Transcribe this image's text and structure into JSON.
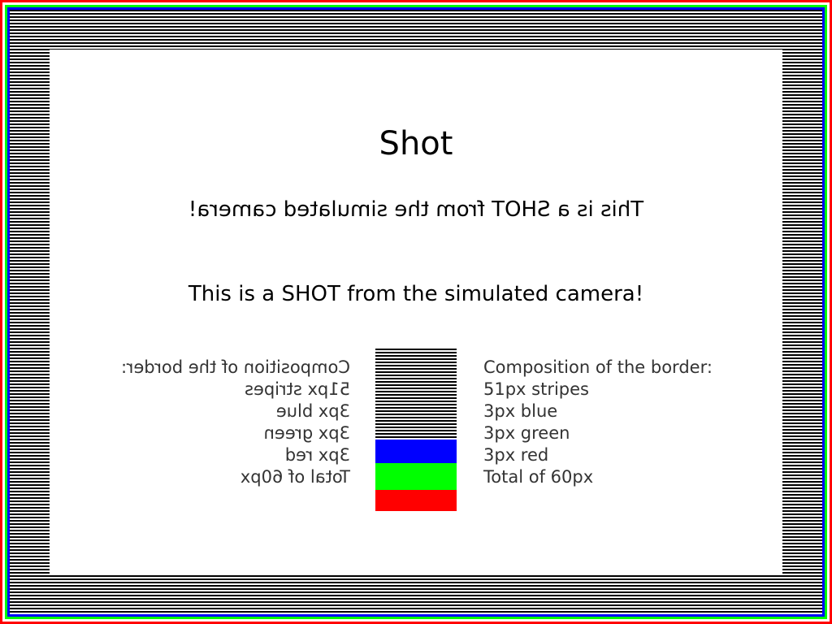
{
  "title": "Shot",
  "shot_text": "This is a SHOT from the simulated camera!",
  "legend": [
    "Composition of the border:",
    "51px stripes",
    "3px blue",
    "3px green",
    "3px red",
    "Total of 60px"
  ],
  "colors": {
    "red": "#ff0000",
    "green": "#00ff00",
    "blue": "#0000ff",
    "stripe": "#000000",
    "background": "#ffffff"
  }
}
